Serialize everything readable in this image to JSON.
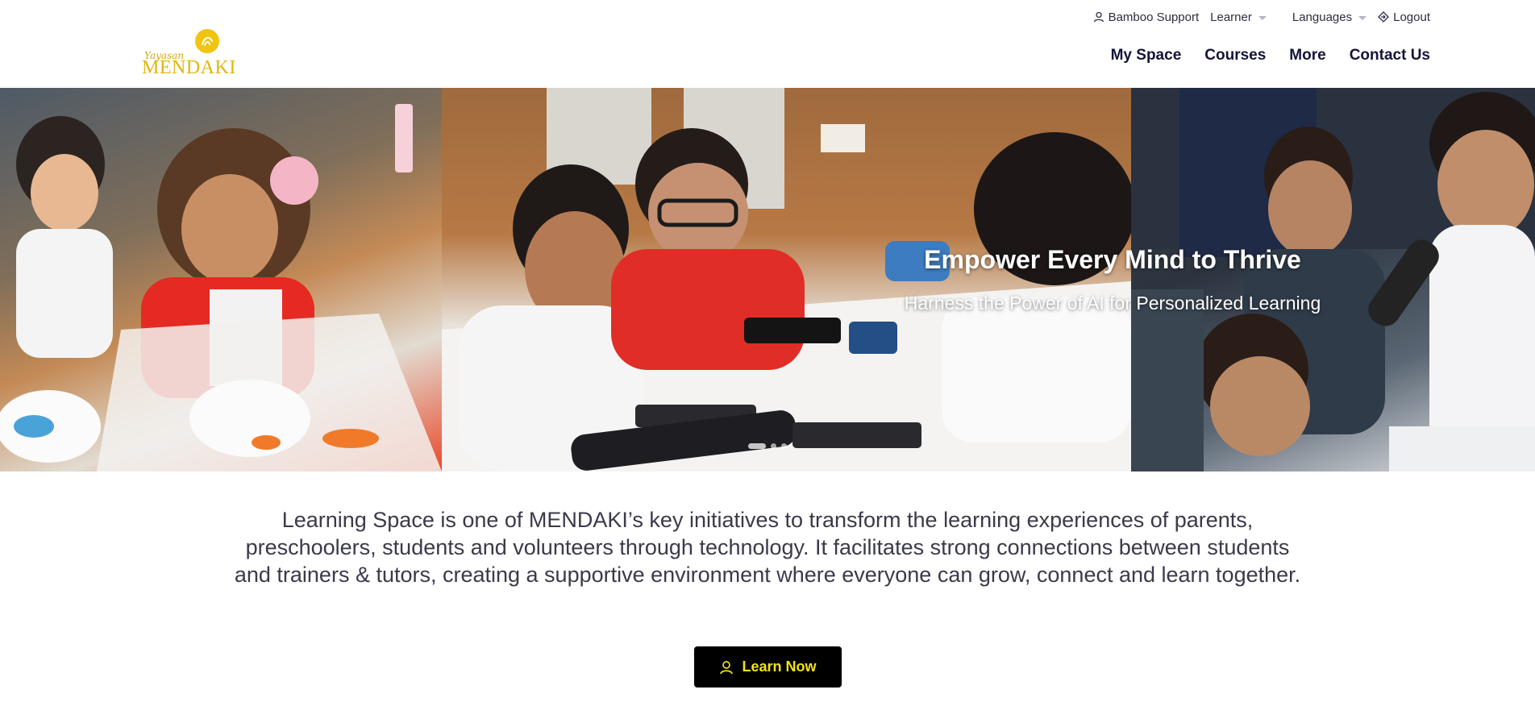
{
  "brand": {
    "logo_script": "Yayasan",
    "logo_word": "MENDAKI",
    "accent_color": "#f0e316",
    "logo_color": "#e2b50e"
  },
  "utility_nav": {
    "support": {
      "label": "Bamboo Support",
      "icon": "user-icon"
    },
    "role": {
      "label": "Learner",
      "icon": "caret-down-icon"
    },
    "languages": {
      "label": "Languages",
      "icon": "caret-down-icon"
    },
    "logout": {
      "label": "Logout",
      "icon": "logout-icon"
    }
  },
  "main_nav": {
    "items": [
      {
        "label": "My Space"
      },
      {
        "label": "Courses"
      },
      {
        "label": "More"
      },
      {
        "label": "Contact Us"
      }
    ]
  },
  "hero": {
    "title": "Empower Every Mind to Thrive",
    "subtitle": "Harness the Power of AI for Personalized Learning",
    "slides_total": 3,
    "active_slide": 1
  },
  "intro": {
    "text": "Learning Space is one of MENDAKI’s key initiatives to transform the learning experiences of parents, preschoolers, students and volunteers through technology. It facilitates strong connections between students and trainers & tutors, creating a supportive environment where everyone can grow, connect and learn together."
  },
  "cta": {
    "label": "Learn Now",
    "icon": "user-icon"
  }
}
